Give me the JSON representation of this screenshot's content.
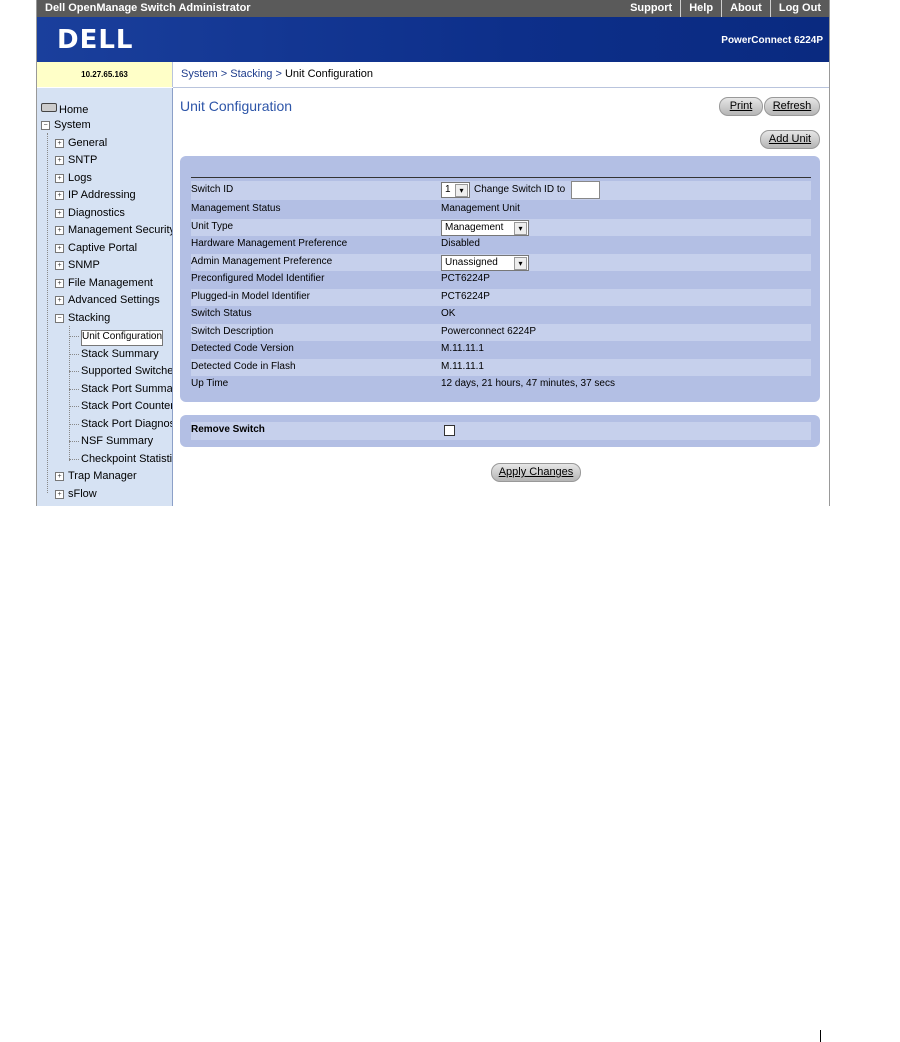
{
  "topbar": {
    "app_title": "Dell OpenManage Switch Administrator",
    "links": [
      "Support",
      "Help",
      "About",
      "Log Out"
    ]
  },
  "brand": {
    "logo": "DELL",
    "product": "PowerConnect 6224P"
  },
  "ip": "10.27.65.163",
  "breadcrumb": {
    "system": "System",
    "stacking": "Stacking",
    "current": "Unit Configuration"
  },
  "sidebar": {
    "home": "Home",
    "system": "System",
    "items": [
      "General",
      "SNTP",
      "Logs",
      "IP Addressing",
      "Diagnostics",
      "Management Security",
      "Captive Portal",
      "SNMP",
      "File Management",
      "Advanced Settings",
      "Stacking"
    ],
    "stacking_children": [
      "Unit Configuration",
      "Stack Summary",
      "Supported Switches",
      "Stack Port Summar",
      "Stack Port Counters",
      "Stack Port Diagnost",
      "NSF Summary",
      "Checkpoint Statistic"
    ],
    "after": [
      "Trap Manager",
      "sFlow"
    ]
  },
  "page": {
    "title": "Unit Configuration",
    "print": "Print",
    "refresh": "Refresh",
    "add_unit": "Add Unit",
    "apply": "Apply Changes"
  },
  "form": {
    "switch_id_label": "Switch ID",
    "switch_id_value": "1",
    "change_switch_id_label": "Change Switch ID to",
    "change_switch_id_value": "",
    "rows": [
      {
        "label": "Management Status",
        "value": "Management Unit"
      },
      {
        "label": "Unit Type",
        "value": "Management"
      },
      {
        "label": "Hardware Management Preference",
        "value": "Disabled"
      },
      {
        "label": "Admin Management Preference",
        "value": "Unassigned"
      },
      {
        "label": "Preconfigured Model Identifier",
        "value": "PCT6224P"
      },
      {
        "label": "Plugged-in Model Identifier",
        "value": "PCT6224P"
      },
      {
        "label": "Switch Status",
        "value": "OK"
      },
      {
        "label": "Switch Description",
        "value": "Powerconnect 6224P"
      },
      {
        "label": "Detected Code Version",
        "value": "M.11.11.1"
      },
      {
        "label": "Detected Code in Flash",
        "value": "M.11.11.1"
      },
      {
        "label": "Up Time",
        "value": "12 days, 21 hours, 47 minutes, 37 secs"
      }
    ],
    "remove_switch_label": "Remove Switch",
    "remove_switch_checked": false
  },
  "colors": {
    "nav_bg": "#d6e2f3",
    "brand_bg": "#0d2f8a",
    "panel_bg": "#b3bfe4",
    "title_color": "#2d55a8"
  }
}
